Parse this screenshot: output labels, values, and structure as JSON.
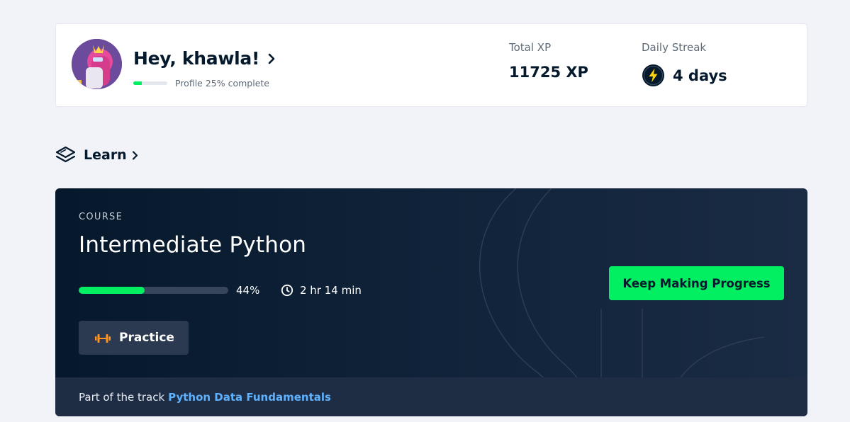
{
  "profile": {
    "greeting": "Hey, khawla!",
    "completion_fraction": 0.25,
    "completion_label": "Profile 25% complete"
  },
  "stats": {
    "xp_label": "Total XP",
    "xp_value": "11725 XP",
    "streak_label": "Daily Streak",
    "streak_value": "4 days"
  },
  "learn": {
    "label": "Learn"
  },
  "course": {
    "kicker": "COURSE",
    "title": "Intermediate Python",
    "progress_fraction": 0.44,
    "progress_label": "44%",
    "time_left": "2 hr 14 min",
    "practice_label": "Practice",
    "cta_label": "Keep Making Progress",
    "track_prefix": "Part of the track",
    "track_name": "Python Data Fundamentals"
  },
  "colors": {
    "accent_green": "#03ef62",
    "navy": "#05192d",
    "link_blue": "#5eb1ff",
    "practice_orange": "#ff931e",
    "streak_yellow": "#ffd400"
  },
  "icons": {
    "avatar": "avatar-illustration",
    "greeting_chevron": "chevron-right-icon",
    "streak": "lightning-bolt-icon",
    "learn": "layers-icon",
    "learn_chevron": "chevron-right-icon",
    "time": "clock-icon",
    "practice": "dumbbell-icon"
  }
}
